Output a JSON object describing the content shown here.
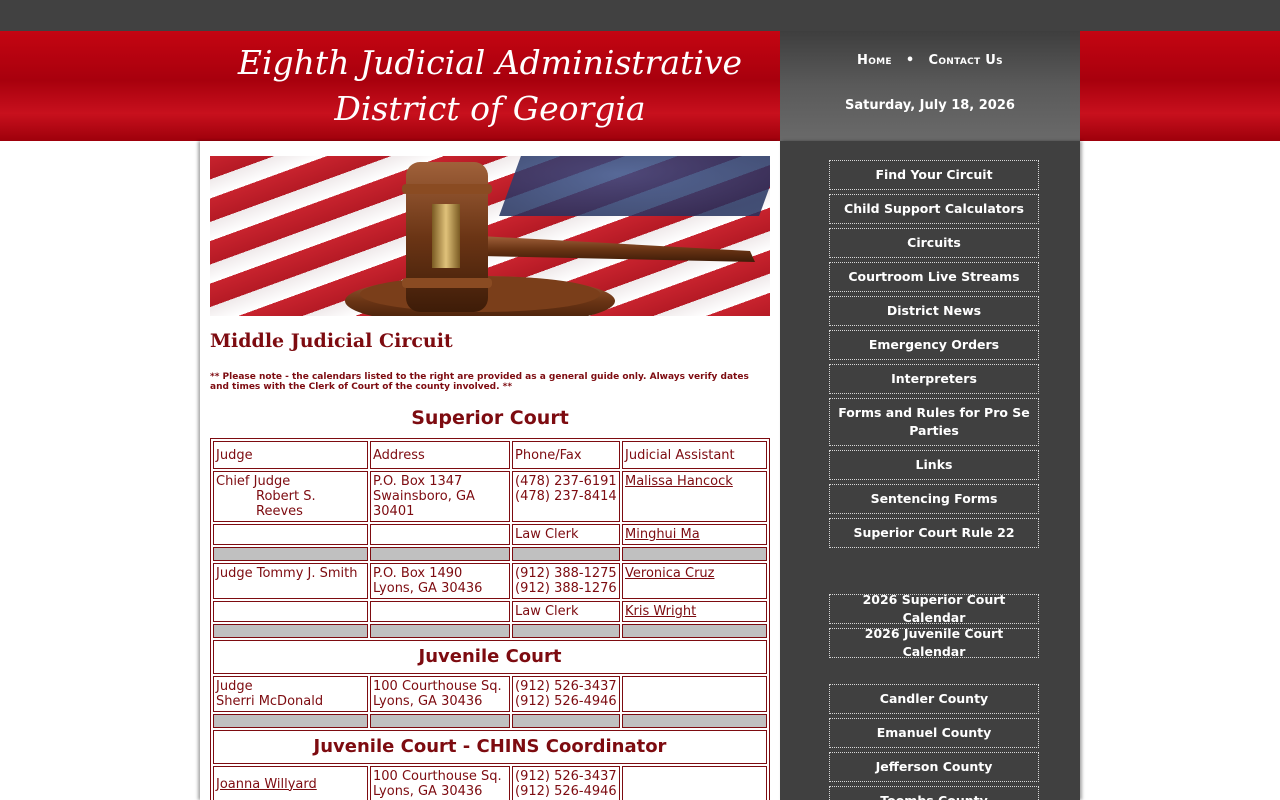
{
  "header": {
    "title": "Eighth Judicial Administrative District of Georgia",
    "nav": [
      "Home",
      "Contact Us"
    ],
    "separator": "•",
    "date": "Saturday, July 18, 2026"
  },
  "main": {
    "heading": "Middle Judicial Circuit",
    "note": "** Please note - the calendars listed to the right are provided as a general guide only. Always verify dates and times with the Clerk of Court of the county involved. **",
    "superior_title": "Superior Court",
    "columns": [
      "Judge",
      "Address",
      "Phone/Fax",
      "Judicial Assistant"
    ],
    "chief": {
      "title": "Chief Judge",
      "name": "Robert S. Reeves",
      "addr1": "P.O. Box 1347",
      "addr2": "Swainsboro, GA 30401",
      "phone": "(478) 237-6191",
      "fax": "(478) 237-8414",
      "assistant": "Malissa Hancock",
      "clerk_label": "Law Clerk",
      "clerk": "Minghui Ma"
    },
    "smith": {
      "name": "Judge Tommy J. Smith",
      "addr1": "P.O. Box 1490",
      "addr2": "Lyons, GA 30436",
      "phone": "(912) 388-1275",
      "fax": "(912) 388-1276",
      "assistant": "Veronica Cruz",
      "clerk_label": "Law Clerk",
      "clerk": "Kris Wright"
    },
    "juvenile_title": "Juvenile Court",
    "juvenile": {
      "title": "Judge",
      "name": "Sherri McDonald",
      "addr1": "100 Courthouse Sq.",
      "addr2": "Lyons, GA 30436",
      "phone": "(912) 526-3437",
      "fax": "(912) 526-4946"
    },
    "chins_title": "Juvenile Court - CHINS Coordinator",
    "chins": {
      "name": "Joanna Willyard",
      "addr1": "100 Courthouse Sq.",
      "addr2": "Lyons, GA 30436",
      "phone": "(912) 526-3437",
      "fax": "(912) 526-4946"
    }
  },
  "sidebar": {
    "menu": [
      "Find Your Circuit",
      "Child Support Calculators",
      "Circuits",
      "Courtroom Live Streams",
      "District News",
      "Emergency Orders",
      "Interpreters",
      "Forms and Rules for Pro Se Parties",
      "Links",
      "Sentencing Forms",
      "Superior Court Rule 22"
    ],
    "calendars": [
      "2026 Superior Court Calendar",
      "2026 Juvenile Court Calendar"
    ],
    "counties": [
      "Candler County",
      "Emanuel County",
      "Jefferson County",
      "Toombs County"
    ]
  }
}
